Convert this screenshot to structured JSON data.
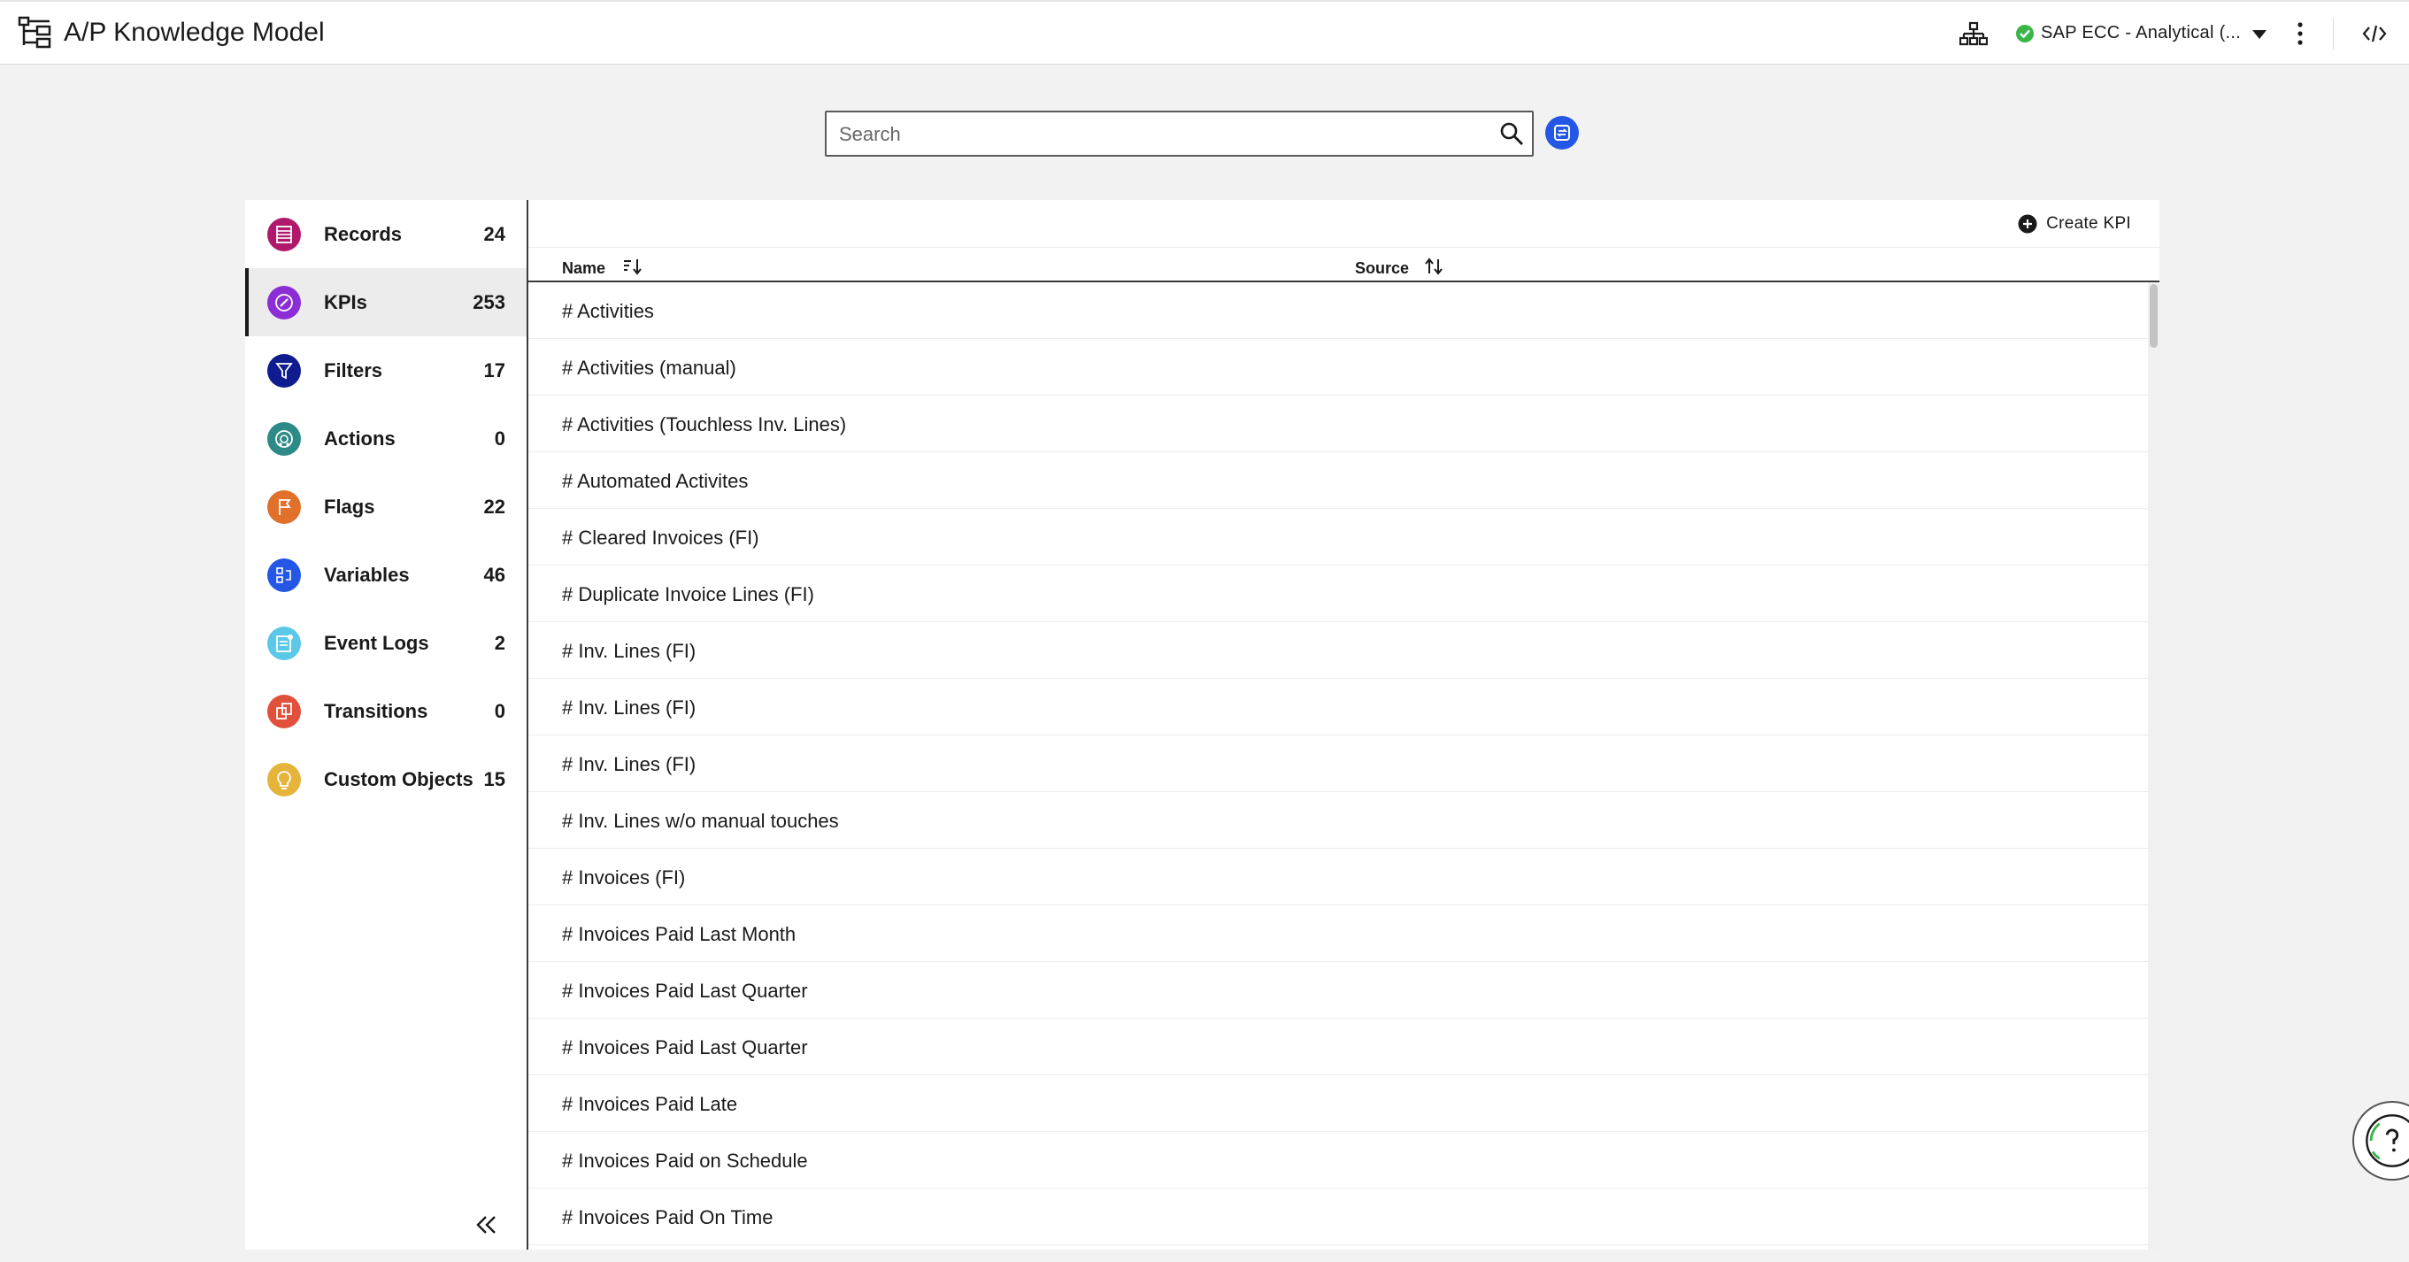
{
  "header": {
    "title": "A/P Knowledge Model",
    "source_label": "SAP ECC - Analytical (...",
    "status_color": "#3ab54a"
  },
  "search": {
    "placeholder": "Search",
    "value": ""
  },
  "sidebar": {
    "items": [
      {
        "label": "Records",
        "count": "24",
        "color": "#b0196b",
        "icon": "records-icon",
        "active": false
      },
      {
        "label": "KPIs",
        "count": "253",
        "color": "#8c2ed6",
        "icon": "kpi-compass-icon",
        "active": true
      },
      {
        "label": "Filters",
        "count": "17",
        "color": "#0f1c8f",
        "icon": "filter-icon",
        "active": false
      },
      {
        "label": "Actions",
        "count": "0",
        "color": "#2e8a86",
        "icon": "actions-icon",
        "active": false
      },
      {
        "label": "Flags",
        "count": "22",
        "color": "#e0702a",
        "icon": "flag-icon",
        "active": false
      },
      {
        "label": "Variables",
        "count": "46",
        "color": "#2457e6",
        "icon": "variables-icon",
        "active": false
      },
      {
        "label": "Event Logs",
        "count": "2",
        "color": "#5bc8e8",
        "icon": "event-logs-icon",
        "active": false
      },
      {
        "label": "Transitions",
        "count": "0",
        "color": "#e0503a",
        "icon": "transitions-icon",
        "active": false
      },
      {
        "label": "Custom Objects",
        "count": "15",
        "color": "#e6b43a",
        "icon": "lightbulb-icon",
        "active": false
      }
    ]
  },
  "main": {
    "create_label": "Create KPI",
    "columns": {
      "name": "Name",
      "source": "Source"
    },
    "rows": [
      "# Activities",
      "# Activities (manual)",
      "# Activities (Touchless Inv. Lines)",
      "# Automated Activites",
      "# Cleared Invoices (FI)",
      "# Duplicate Invoice Lines (FI)",
      "# Inv. Lines (FI)",
      "# Inv. Lines (FI)",
      "# Inv. Lines (FI)",
      "# Inv. Lines w/o manual touches",
      "# Invoices (FI)",
      "# Invoices Paid Last Month",
      "# Invoices Paid Last Quarter",
      "# Invoices Paid Last Quarter",
      "# Invoices Paid Late",
      "# Invoices Paid on Schedule",
      "# Invoices Paid On Time"
    ]
  }
}
